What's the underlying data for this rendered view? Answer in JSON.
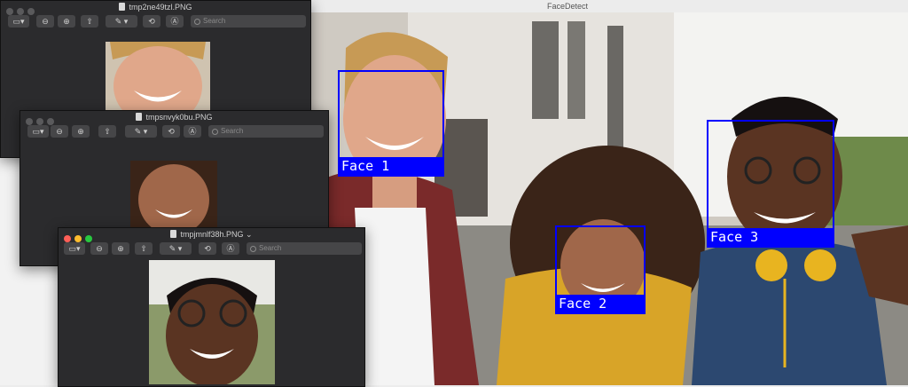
{
  "main_window": {
    "title": "FaceDetect",
    "faces": [
      {
        "label": "Face 1"
      },
      {
        "label": "Face 2"
      },
      {
        "label": "Face 3"
      }
    ]
  },
  "preview_windows": [
    {
      "title": "tmp2ne49tzl.PNG",
      "search_placeholder": "Search"
    },
    {
      "title": "tmpsnvyk0bu.PNG",
      "search_placeholder": "Search"
    },
    {
      "title": "tmpjmnlf38h.PNG ⌄",
      "search_placeholder": "Search"
    }
  ],
  "colors": {
    "face_box": "#0000ff",
    "window_bg": "#2b2b2d",
    "close": "#ff5f57",
    "minimize": "#febc2e",
    "zoom": "#28c840"
  },
  "toolbar_icons": [
    "sidebar-icon",
    "zoom-out-icon",
    "zoom-in-icon",
    "share-icon",
    "markup-pen-icon",
    "rotate-icon",
    "annotate-icon",
    "search-icon"
  ]
}
